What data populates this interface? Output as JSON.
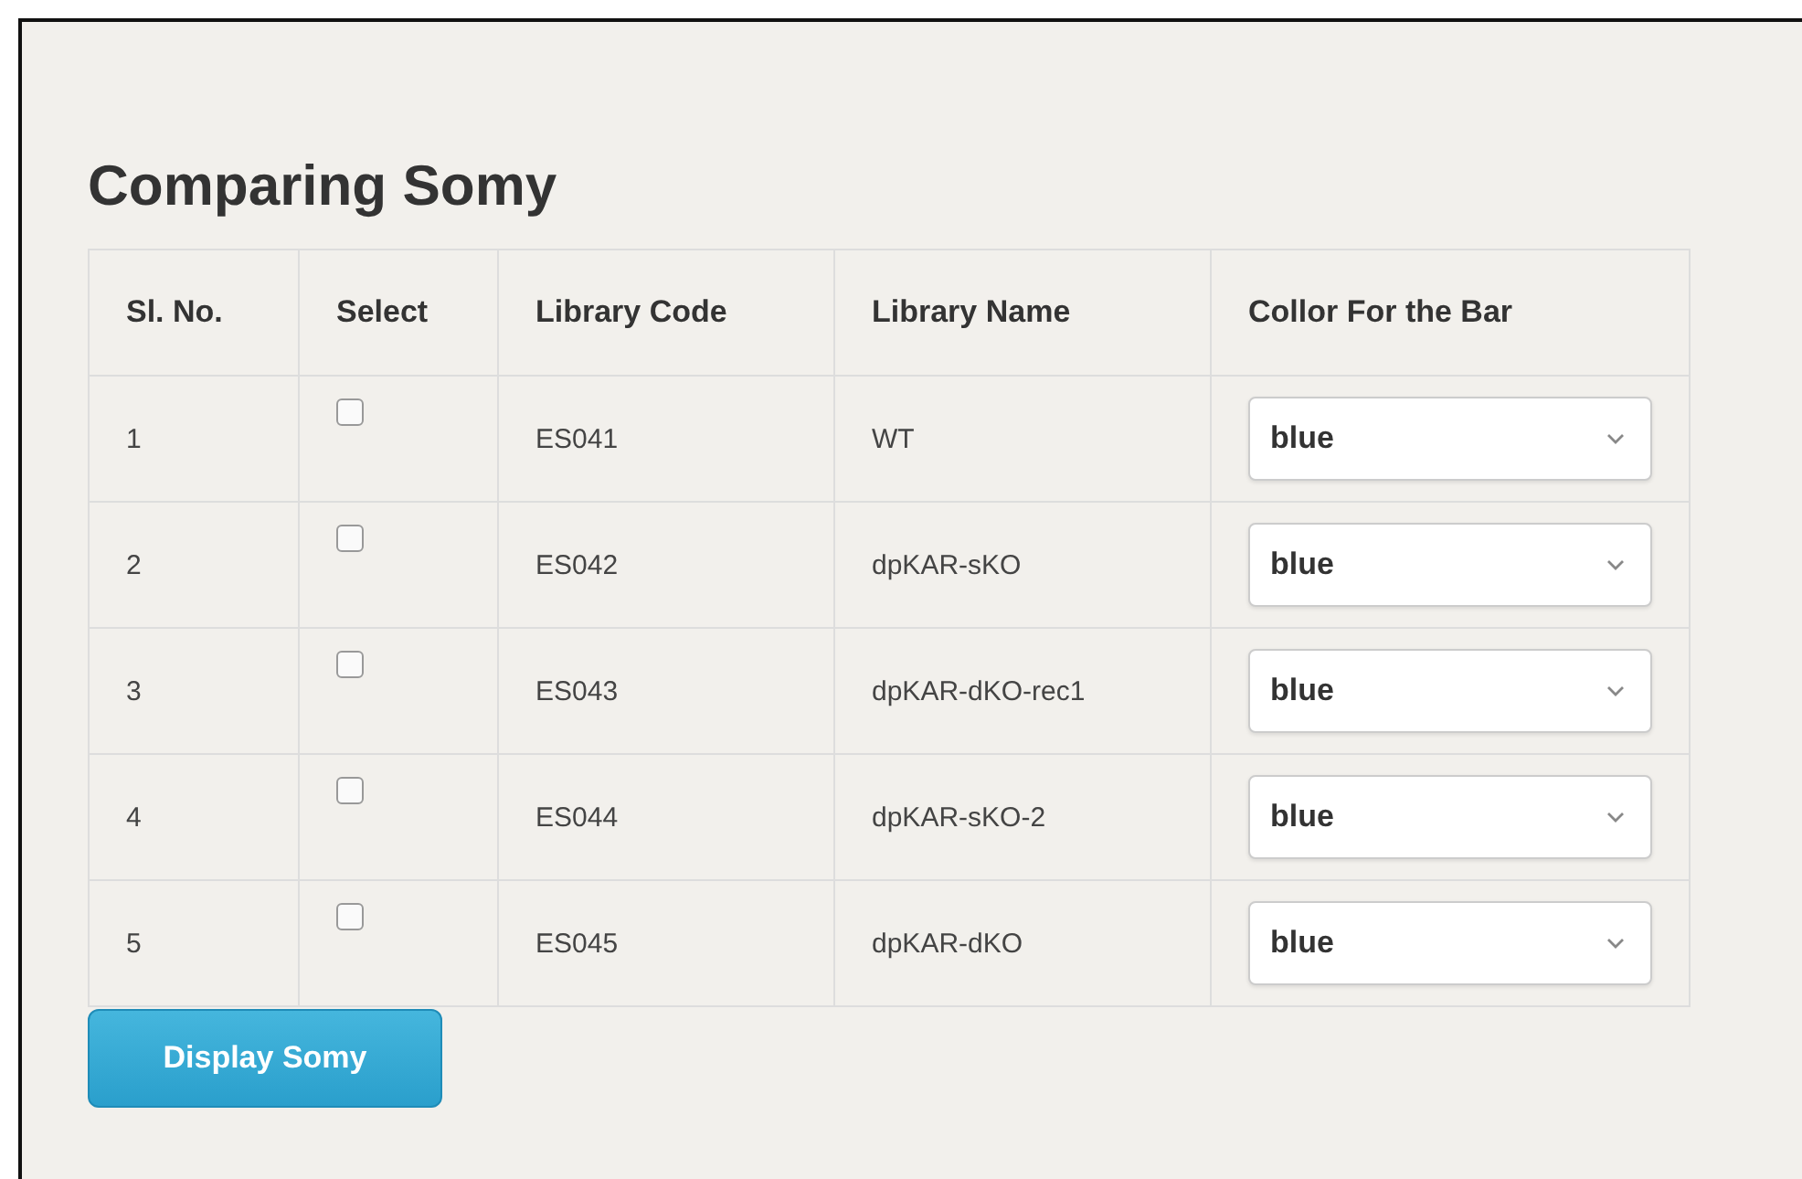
{
  "title": "Comparing Somy",
  "table": {
    "columns": [
      "Sl. No.",
      "Select",
      "Library Code",
      "Library Name",
      "Collor For the Bar"
    ],
    "rows": [
      {
        "number": "1",
        "checked": false,
        "code": "ES041",
        "name": "WT",
        "color_choice": "blue"
      },
      {
        "number": "2",
        "checked": false,
        "code": "ES042",
        "name": "dpKAR-sKO",
        "color_choice": "blue"
      },
      {
        "number": "3",
        "checked": false,
        "code": "ES043",
        "name": "dpKAR-dKO-rec1",
        "color_choice": "blue"
      },
      {
        "number": "4",
        "checked": false,
        "code": "ES044",
        "name": "dpKAR-sKO-2",
        "color_choice": "blue"
      },
      {
        "number": "5",
        "checked": false,
        "code": "ES045",
        "name": "dpKAR-dKO",
        "color_choice": "blue"
      }
    ]
  },
  "button": "Display Somy"
}
